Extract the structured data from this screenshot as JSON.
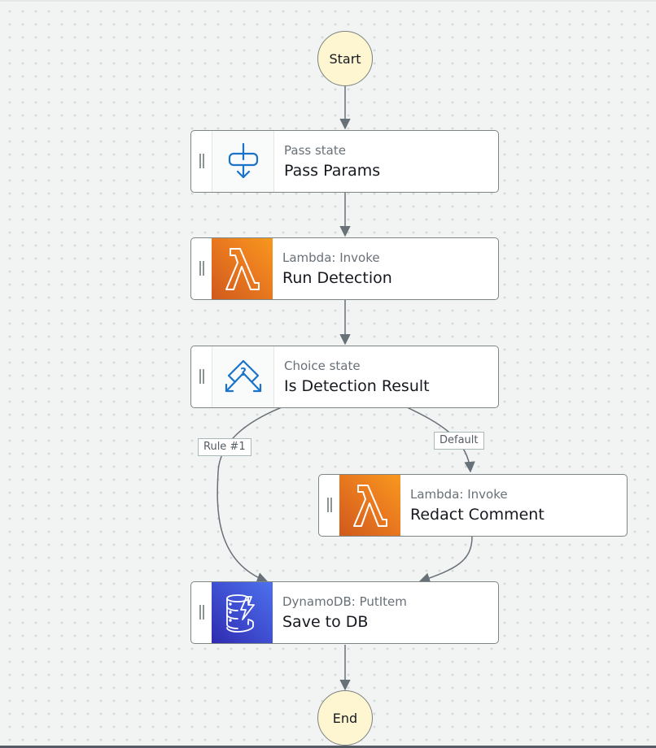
{
  "workflow": {
    "start": {
      "label": "Start"
    },
    "end": {
      "label": "End"
    },
    "states": [
      {
        "id": "pass-params",
        "type": "Pass state",
        "name": "Pass Params",
        "icon": "pass-state-icon"
      },
      {
        "id": "run-detection",
        "type": "Lambda: Invoke",
        "name": "Run Detection",
        "icon": "lambda-icon"
      },
      {
        "id": "is-detection-result",
        "type": "Choice state",
        "name": "Is Detection Result",
        "icon": "choice-state-icon"
      },
      {
        "id": "redact-comment",
        "type": "Lambda: Invoke",
        "name": "Redact Comment",
        "icon": "lambda-icon"
      },
      {
        "id": "save-to-db",
        "type": "DynamoDB: PutItem",
        "name": "Save to DB",
        "icon": "dynamodb-icon"
      }
    ],
    "edge_labels": {
      "rule1": "Rule #1",
      "default": "Default"
    }
  },
  "colors": {
    "terminal_fill": "#fdf6d1",
    "lambda_orange": "#ea7a1f",
    "dynamodb_blue": "#3f4fd1",
    "flow_icon_blue": "#1a73c8",
    "edge": "#687078"
  }
}
